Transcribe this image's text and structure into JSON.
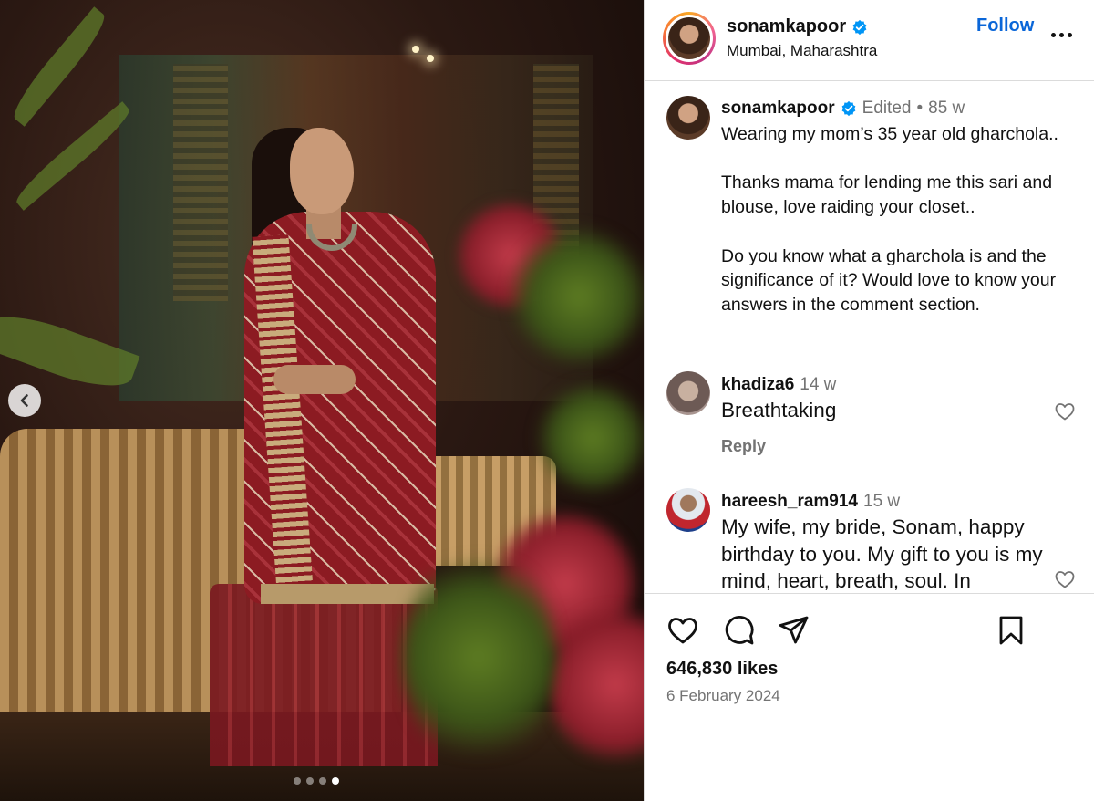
{
  "header": {
    "username": "sonamkapoor",
    "location": "Mumbai, Maharashtra",
    "follow_label": "Follow"
  },
  "media": {
    "slide_count": 4,
    "active_slide": 4
  },
  "caption": {
    "username": "sonamkapoor",
    "edited_label": "Edited",
    "separator": "•",
    "age": "85 w",
    "text": "Wearing my mom’s 35 year old gharchola..\n\nThanks mama for lending me this sari and blouse, love raiding your closet..\n\nDo you know what a gharchola is and the significance of it? Would love to know your answers in the comment section."
  },
  "comments": [
    {
      "username": "khadiza6",
      "age": "14 w",
      "text": "Breathtaking",
      "reply_label": "Reply"
    },
    {
      "username": "hareesh_ram914",
      "age": "15 w",
      "text": "My wife, my bride, Sonam, happy birthday to you. My gift to you is my mind, heart, breath, soul. In"
    }
  ],
  "footer": {
    "likes": "646,830 likes",
    "date": "6 February 2024"
  },
  "icons": {
    "verified_color": "#0095f6",
    "follow_color": "#0a66d8"
  }
}
